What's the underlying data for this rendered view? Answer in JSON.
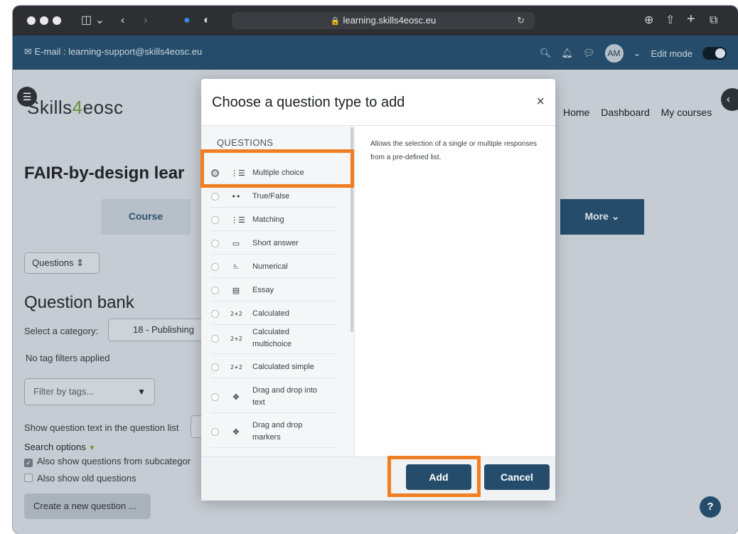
{
  "browser": {
    "url": "learning.skills4eosc.eu"
  },
  "topbar": {
    "email": "✉ E-mail : learning-support@skills4eosc.eu",
    "avatar_initials": "AM",
    "edit_mode_label": "Edit mode"
  },
  "site": {
    "logo_part1": "Skills",
    "logo_part2": "4",
    "logo_part3": "eosc",
    "nav": [
      "Home",
      "Dashboard",
      "My courses"
    ]
  },
  "course": {
    "title": "FAIR-by-design lear",
    "tab_course": "Course",
    "tab_more": "More ⌄"
  },
  "bank": {
    "nav_select": "Questions ⇕",
    "heading": "Question bank",
    "category_label": "Select a category:",
    "category_value": "18 - Publishing",
    "no_tag_filters": "No tag filters applied",
    "filter_placeholder": "Filter by tags...",
    "show_question_text": "Show question text in the question list",
    "search_options": "Search options",
    "also_subcategories": "Also show questions from subcategor",
    "also_old": "Also show old questions",
    "create_button": "Create a new question ..."
  },
  "modal": {
    "title": "Choose a question type to add",
    "close": "×",
    "list_heading": "QUESTIONS",
    "description": "Allows the selection of a single or multiple responses from a pre-defined list.",
    "add_label": "Add",
    "cancel_label": "Cancel",
    "question_types": [
      {
        "label": "Multiple choice",
        "icon": "list-icon",
        "glyph": "⋮☰",
        "selected": true
      },
      {
        "label": "True/False",
        "icon": "two-dots-icon",
        "glyph": "••",
        "selected": false
      },
      {
        "label": "Matching",
        "icon": "matching-icon",
        "glyph": "⋮☰",
        "selected": false
      },
      {
        "label": "Short answer",
        "icon": "short-answer-icon",
        "glyph": "▭",
        "selected": false
      },
      {
        "label": "Numerical",
        "icon": "numerical-icon",
        "glyph": "⎁",
        "selected": false
      },
      {
        "label": "Essay",
        "icon": "essay-icon",
        "glyph": "▤",
        "selected": false
      },
      {
        "label": "Calculated",
        "icon": "calculated-icon",
        "glyph": "2+2",
        "selected": false
      },
      {
        "label": "Calculated multichoice",
        "icon": "calculated-multichoice-icon",
        "glyph": "2+2",
        "selected": false
      },
      {
        "label": "Calculated simple",
        "icon": "calculated-simple-icon",
        "glyph": "2+2",
        "selected": false
      },
      {
        "label": "Drag and drop into text",
        "icon": "move-icon",
        "glyph": "✥",
        "selected": false
      },
      {
        "label": "Drag and drop markers",
        "icon": "move-icon",
        "glyph": "✥",
        "selected": false
      }
    ]
  },
  "help": "?"
}
